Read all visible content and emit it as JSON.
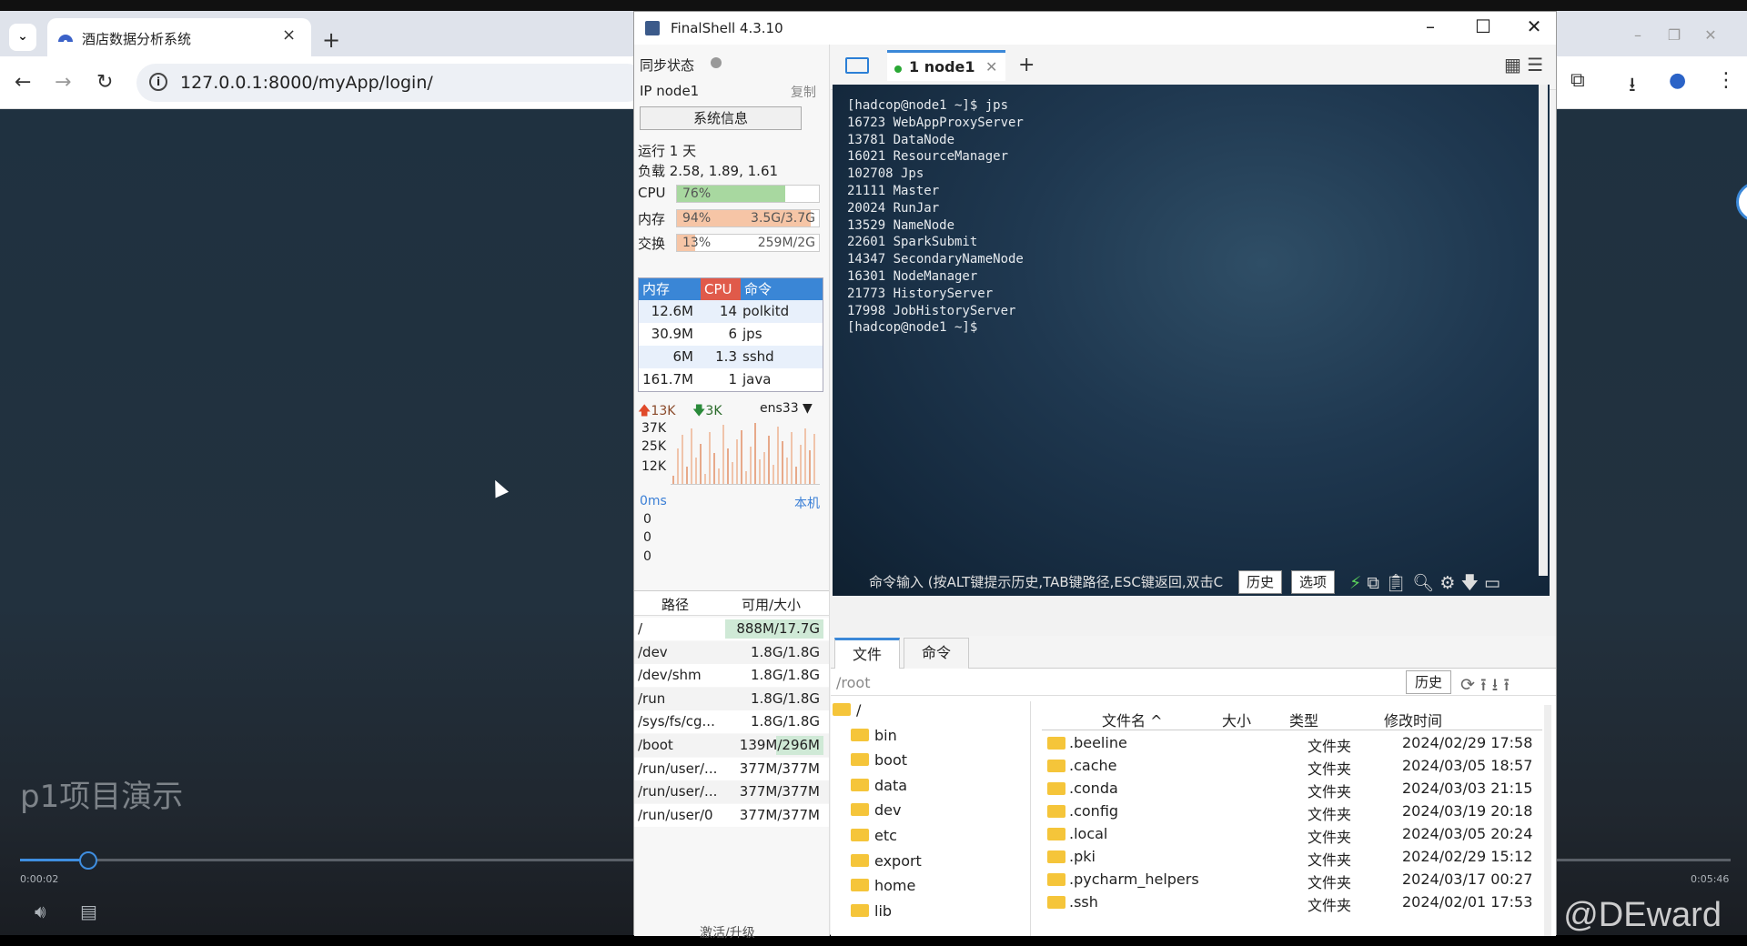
{
  "browser": {
    "tab_title": "酒店数据分析系统",
    "url": "127.0.0.1:8000/myApp/login/"
  },
  "video": {
    "title": "p1项目演示",
    "time_current": "0:00:02",
    "time_total": "0:05:46",
    "progress": 0.04,
    "watermark": "CSDN @DEward"
  },
  "finalshell": {
    "title": "FinalShell 4.3.10",
    "sync_label": "同步状态",
    "ip_label": "IP  node1",
    "copy_label": "复制",
    "sysinfo_button": "系统信息",
    "uptime": "运行 1 天",
    "load": "负载 2.58, 1.89, 1.61",
    "cpu": {
      "label": "CPU",
      "pct": "76%",
      "fill": 0.76,
      "value": ""
    },
    "mem": {
      "label": "内存",
      "pct": "94%",
      "fill": 0.94,
      "value": "3.5G/3.7G"
    },
    "swap": {
      "label": "交换",
      "pct": "13%",
      "fill": 0.13,
      "value": "259M/2G"
    },
    "proc_headers": [
      "内存",
      "CPU",
      "命令"
    ],
    "processes": [
      {
        "mem": "12.6M",
        "cpu": "14",
        "cmd": "polkitd"
      },
      {
        "mem": "30.9M",
        "cpu": "6",
        "cmd": "jps"
      },
      {
        "mem": "6M",
        "cpu": "1.3",
        "cmd": "sshd"
      },
      {
        "mem": "161.7M",
        "cpu": "1",
        "cmd": "java"
      }
    ],
    "net": {
      "up": "13K",
      "down": "3K",
      "iface": "ens33",
      "ticks": [
        "37K",
        "25K",
        "12K"
      ]
    },
    "ping": {
      "label": "0ms",
      "target": "本机",
      "values": [
        "0",
        "0",
        "0"
      ]
    },
    "disk_headers": [
      "路径",
      "可用/大小"
    ],
    "disks": [
      {
        "path": "/",
        "size": "888M/17.7G"
      },
      {
        "path": "/dev",
        "size": "1.8G/1.8G"
      },
      {
        "path": "/dev/shm",
        "size": "1.8G/1.8G"
      },
      {
        "path": "/run",
        "size": "1.8G/1.8G"
      },
      {
        "path": "/sys/fs/cg...",
        "size": "1.8G/1.8G"
      },
      {
        "path": "/boot",
        "size": "139M/296M"
      },
      {
        "path": "/run/user/...",
        "size": "377M/377M"
      },
      {
        "path": "/run/user/...",
        "size": "377M/377M"
      },
      {
        "path": "/run/user/0",
        "size": "377M/377M"
      }
    ],
    "activate": "激活/升级",
    "session_tab": "1  node1",
    "terminal_lines": [
      "[hadcop@node1 ~]$ jps",
      "16723 WebAppProxyServer",
      "13781 DataNode",
      "16021 ResourceManager",
      "102708 Jps",
      "21111 Master",
      "20024 RunJar",
      "13529 NameNode",
      "22601 SparkSubmit",
      "14347 SecondaryNameNode",
      "16301 NodeManager",
      "21773 HistoryServer",
      "17998 JobHistoryServer",
      "[hadcop@node1 ~]$ "
    ],
    "cmd_placeholder": "命令输入 (按ALT键提示历史,TAB键路径,ESC键返回,双击C",
    "cmd_history": "历史",
    "cmd_options": "选项",
    "file_tabs": [
      "文件",
      "命令"
    ],
    "path": "/root",
    "path_history": "历史",
    "tree": [
      "/",
      "bin",
      "boot",
      "data",
      "dev",
      "etc",
      "export",
      "home",
      "lib"
    ],
    "file_headers": [
      "文件名 ^",
      "大小",
      "类型",
      "修改时间"
    ],
    "files": [
      {
        "name": ".beeline",
        "size": "",
        "type": "文件夹",
        "time": "2024/02/29 17:58"
      },
      {
        "name": ".cache",
        "size": "",
        "type": "文件夹",
        "time": "2024/03/05 18:57"
      },
      {
        "name": ".conda",
        "size": "",
        "type": "文件夹",
        "time": "2024/03/03 21:15"
      },
      {
        "name": ".config",
        "size": "",
        "type": "文件夹",
        "time": "2024/03/19 20:18"
      },
      {
        "name": ".local",
        "size": "",
        "type": "文件夹",
        "time": "2024/03/05 20:24"
      },
      {
        "name": ".pki",
        "size": "",
        "type": "文件夹",
        "time": "2024/02/29 15:12"
      },
      {
        "name": ".pycharm_helpers",
        "size": "",
        "type": "文件夹",
        "time": "2024/03/17 00:27"
      },
      {
        "name": ".ssh",
        "size": "",
        "type": "文件夹",
        "time": "2024/02/01 17:53"
      }
    ]
  }
}
